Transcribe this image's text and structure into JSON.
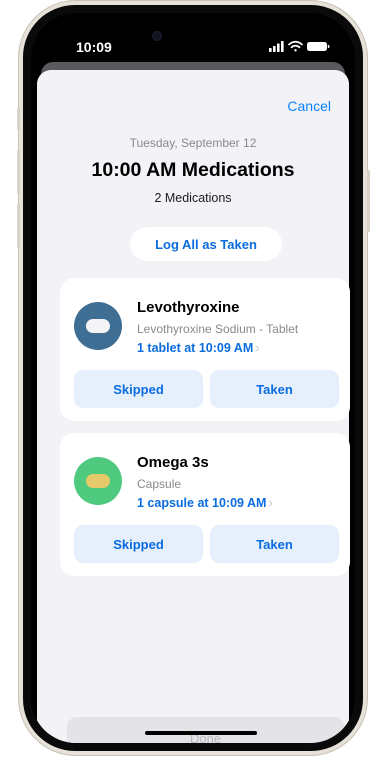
{
  "status_bar": {
    "time": "10:09"
  },
  "header": {
    "cancel_label": "Cancel",
    "date": "Tuesday, September 12",
    "title": "10:00 AM Medications",
    "count": "2 Medications"
  },
  "log_all_label": "Log All as Taken",
  "medications": [
    {
      "name": "Levothyroxine",
      "detail": "Levothyroxine Sodium - Tablet",
      "log": "1 tablet at 10:09 AM",
      "icon": "tablet-icon",
      "icon_bg": "#3e6e93",
      "pill_color": "#f4f4f6",
      "skip_label": "Skipped",
      "take_label": "Taken"
    },
    {
      "name": "Omega 3s",
      "detail": "Capsule",
      "log": "1 capsule at 10:09 AM",
      "icon": "capsule-icon",
      "icon_bg": "#4fc97d",
      "pill_color": "#e6c96a",
      "skip_label": "Skipped",
      "take_label": "Taken"
    }
  ],
  "done_label": "Done",
  "colors": {
    "accent": "#0a6cde",
    "sheet_bg": "#f2f2f7",
    "button_bg": "#e6f0fd"
  }
}
